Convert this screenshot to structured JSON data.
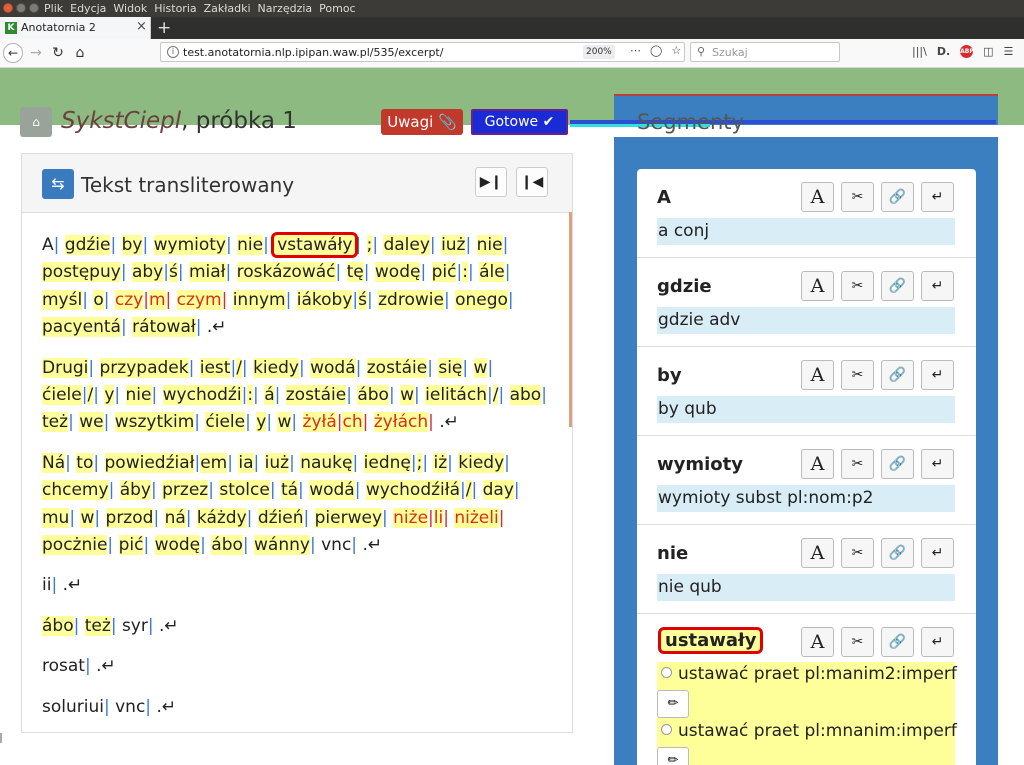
{
  "menubar": {
    "items": [
      "Plik",
      "Edycja",
      "Widok",
      "Historia",
      "Zakładki",
      "Narzędzia",
      "Pomoc"
    ]
  },
  "tab": {
    "favicon": "K",
    "title": "Anotatornia 2",
    "close": "×",
    "new_tab": "+"
  },
  "navbar": {
    "url": "test.anotatornia.nlp.ipipan.waw.pl/535/excerpt/",
    "zoom": "200%",
    "search_placeholder": "Szukaj",
    "abp": "ABP"
  },
  "header": {
    "title_italic": "SykstCiepl",
    "title_rest": ", próbka 1",
    "uwagi_label": "Uwagi",
    "gotowe_label": "Gotowe",
    "segments_title": "Segmenty"
  },
  "left_panel": {
    "title": "Tekst transliterowany",
    "paragraphs": [
      [
        {
          "t": "A",
          "s": "plain"
        },
        {
          "t": "gdźie"
        },
        {
          "t": "by"
        },
        {
          "t": "wymioty"
        },
        {
          "t": "nie"
        },
        {
          "t": "vstawáły",
          "s": "sel"
        },
        {
          "t": ";"
        },
        {
          "t": "daley"
        },
        {
          "t": "iuż"
        },
        {
          "t": "nie"
        },
        {
          "t": "postępuy"
        },
        {
          "t": "aby",
          "nob": true
        },
        {
          "t": "ś"
        },
        {
          "t": "miał"
        },
        {
          "t": "roskázowáć"
        },
        {
          "t": "tę"
        },
        {
          "t": "wodę"
        },
        {
          "t": "pić",
          "nob": true
        },
        {
          "t": ":"
        },
        {
          "t": "ále"
        },
        {
          "t": "myśl"
        },
        {
          "t": "o"
        },
        {
          "t": "czy",
          "s": "red",
          "nob": true
        },
        {
          "t": "m",
          "s": "red"
        },
        {
          "t": "czym",
          "s": "red"
        },
        {
          "t": "innym"
        },
        {
          "t": "iákoby",
          "nob": true
        },
        {
          "t": "ś"
        },
        {
          "t": "zdrowie"
        },
        {
          "t": "onego"
        },
        {
          "t": "pacyentá"
        },
        {
          "t": "rátował"
        },
        {
          "t": ".↵",
          "s": "plain",
          "end": true
        }
      ],
      [
        {
          "t": "Drugi"
        },
        {
          "t": "przypadek"
        },
        {
          "t": "iest",
          "nob": true
        },
        {
          "t": "/"
        },
        {
          "t": "kiedy"
        },
        {
          "t": "wodá"
        },
        {
          "t": "zostáie"
        },
        {
          "t": "się"
        },
        {
          "t": "w"
        },
        {
          "t": "ćiele",
          "nob": true
        },
        {
          "t": "/"
        },
        {
          "t": "y"
        },
        {
          "t": "nie"
        },
        {
          "t": "wychodźi",
          "nob": true
        },
        {
          "t": ":"
        },
        {
          "t": "á"
        },
        {
          "t": "zostáie"
        },
        {
          "t": "ábo"
        },
        {
          "t": "w"
        },
        {
          "t": "ielitách",
          "nob": true
        },
        {
          "t": "/"
        },
        {
          "t": "abo"
        },
        {
          "t": "też"
        },
        {
          "t": "we"
        },
        {
          "t": "wszytkim"
        },
        {
          "t": "ćiele"
        },
        {
          "t": "y"
        },
        {
          "t": "w"
        },
        {
          "t": "żyłá",
          "s": "red",
          "nob": true
        },
        {
          "t": "ch",
          "s": "red"
        },
        {
          "t": "żyłách",
          "s": "red"
        },
        {
          "t": ".↵",
          "s": "plain",
          "end": true
        }
      ],
      [
        {
          "t": "Ná"
        },
        {
          "t": "to"
        },
        {
          "t": "powiedźiał",
          "nob": true
        },
        {
          "t": "em"
        },
        {
          "t": "ia"
        },
        {
          "t": "iuż"
        },
        {
          "t": "naukę"
        },
        {
          "t": "iednę",
          "nob": true
        },
        {
          "t": ";"
        },
        {
          "t": "iż"
        },
        {
          "t": "kiedy"
        },
        {
          "t": "chcemy"
        },
        {
          "t": "áby"
        },
        {
          "t": "przez"
        },
        {
          "t": "stolce"
        },
        {
          "t": "tá"
        },
        {
          "t": "wodá"
        },
        {
          "t": "wychodźiłá",
          "nob": true
        },
        {
          "t": "/"
        },
        {
          "t": "day"
        },
        {
          "t": "mu"
        },
        {
          "t": "w"
        },
        {
          "t": "przod"
        },
        {
          "t": "ná"
        },
        {
          "t": "káżdy"
        },
        {
          "t": "dźień"
        },
        {
          "t": "pierwey"
        },
        {
          "t": "niże",
          "s": "red",
          "nob": true
        },
        {
          "t": "li",
          "s": "red"
        },
        {
          "t": "niżeli",
          "s": "red"
        },
        {
          "t": "pocżnie"
        },
        {
          "t": "pić"
        },
        {
          "t": "wodę"
        },
        {
          "t": "ábo"
        },
        {
          "t": "wánny"
        },
        {
          "t": "vnc",
          "s": "plain"
        },
        {
          "t": ".↵",
          "s": "plain",
          "end": true
        }
      ],
      [
        {
          "t": "ii",
          "s": "plain"
        },
        {
          "t": ".↵",
          "s": "plain",
          "end": true
        }
      ],
      [
        {
          "t": "ábo"
        },
        {
          "t": "też"
        },
        {
          "t": "syr",
          "s": "plain"
        },
        {
          "t": ".↵",
          "s": "plain",
          "end": true
        }
      ],
      [
        {
          "t": "rosat",
          "s": "plain"
        },
        {
          "t": ".↵",
          "s": "plain",
          "end": true
        }
      ],
      [
        {
          "t": "soluriui",
          "s": "plain"
        },
        {
          "t": "vnc",
          "s": "plain"
        },
        {
          "t": ".↵",
          "s": "plain",
          "end": true
        }
      ]
    ]
  },
  "segments": [
    {
      "token": "A",
      "interp": "a conj"
    },
    {
      "token": "gdzie",
      "interp": "gdzie adv"
    },
    {
      "token": "by",
      "interp": "by qub"
    },
    {
      "token": "wymioty",
      "interp": "wymioty subst pl:nom:p2"
    },
    {
      "token": "nie",
      "interp": "nie qub"
    },
    {
      "token": "ustawały",
      "selected": true,
      "options": [
        "ustawać praet pl:manim2:imperf",
        "ustawać praet pl:mnanim:imperf"
      ]
    }
  ],
  "icons": {
    "font": "A",
    "cut": "✂",
    "link": "🔗",
    "enter": "↵",
    "edit": "✏"
  }
}
